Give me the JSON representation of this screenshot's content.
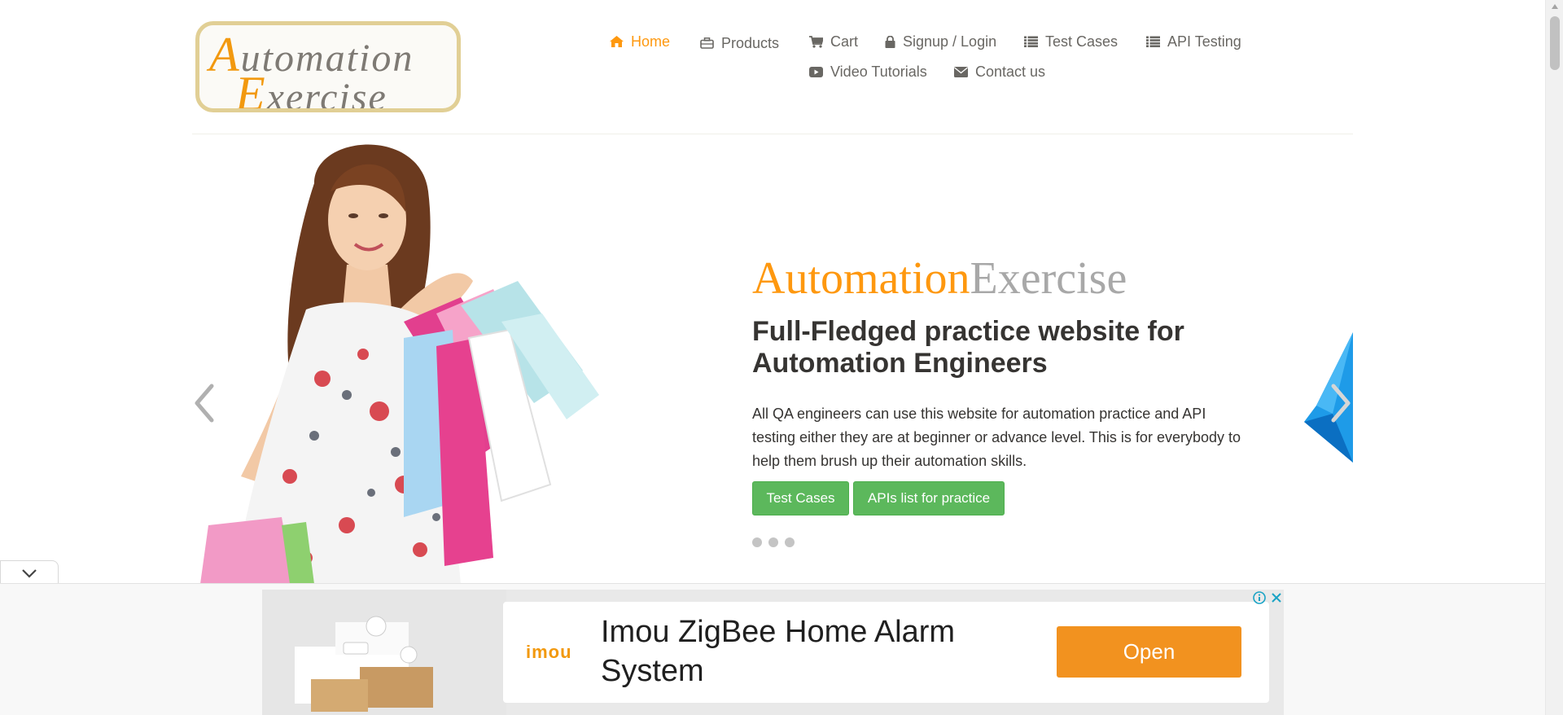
{
  "logo": {
    "line1_first": "A",
    "line1_rest": "utomation",
    "line2_first": "E",
    "line2_rest": "xercise"
  },
  "nav": {
    "items": [
      {
        "label": "Home",
        "icon": "home-icon",
        "active": true
      },
      {
        "label": "Products",
        "icon": "briefcase-icon"
      },
      {
        "label": "Cart",
        "icon": "cart-icon"
      },
      {
        "label": "Signup / Login",
        "icon": "lock-icon"
      },
      {
        "label": "Test Cases",
        "icon": "list-icon"
      },
      {
        "label": "API Testing",
        "icon": "list-icon"
      },
      {
        "label": "Video Tutorials",
        "icon": "youtube-icon"
      },
      {
        "label": "Contact us",
        "icon": "envelope-icon"
      }
    ]
  },
  "hero": {
    "brand_orange": "Automation",
    "brand_gray": "Exercise",
    "heading_line1": "Full-Fledged practice website for",
    "heading_line2": "Automation Engineers",
    "description": "All QA engineers can use this website for automation practice and API testing either they are at beginner or advance level. This is for everybody to help them brush up their automation skills.",
    "btn_test_cases": "Test Cases",
    "btn_apis": "APIs list for practice",
    "slide_count": 3
  },
  "ad": {
    "brand": "imou",
    "title": "Imou ZigBee Home Alarm System",
    "cta": "Open"
  },
  "colors": {
    "accent": "#fe980f",
    "nav_text": "#696763",
    "button_green": "#5cb85c",
    "ad_cta": "#f2921f"
  }
}
